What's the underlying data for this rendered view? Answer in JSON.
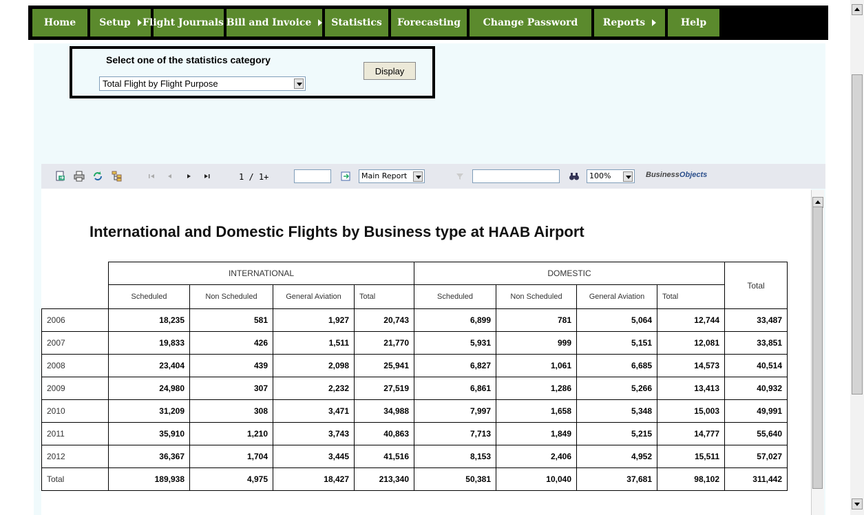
{
  "nav": {
    "items": [
      {
        "label": "Home",
        "arrow": false
      },
      {
        "label": "Setup",
        "arrow": true
      },
      {
        "label": "Flight Journals",
        "arrow": true
      },
      {
        "label": "Bill and Invoice",
        "arrow": true
      },
      {
        "label": "Statistics",
        "arrow": false
      },
      {
        "label": "Forecasting",
        "arrow": false
      },
      {
        "label": "Change Password",
        "arrow": false
      },
      {
        "label": "Reports",
        "arrow": true
      },
      {
        "label": "Help",
        "arrow": false
      }
    ]
  },
  "category": {
    "heading": "Select one of the statistics category",
    "selected": "Total Flight by Flight Purpose",
    "display_label": "Display"
  },
  "toolbar": {
    "page": "1 / 1+",
    "report_select": "Main Report",
    "zoom": "100%",
    "logo_a": "Business",
    "logo_b": "Objects"
  },
  "report": {
    "title_pre": "International and Domestic Flights by Business type at ",
    "airport": "HAAB",
    "title_post": " Airport",
    "group_headers": [
      "INTERNATIONAL",
      "DOMESTIC",
      "Total"
    ],
    "sub_headers": [
      "Scheduled",
      "Non Scheduled",
      "General Aviation",
      "Total",
      "Scheduled",
      "Non Scheduled",
      "General Aviation",
      "Total"
    ],
    "rows": [
      {
        "year": "2006",
        "values": [
          "18,235",
          "581",
          "1,927",
          "20,743",
          "6,899",
          "781",
          "5,064",
          "12,744",
          "33,487"
        ]
      },
      {
        "year": "2007",
        "values": [
          "19,833",
          "426",
          "1,511",
          "21,770",
          "5,931",
          "999",
          "5,151",
          "12,081",
          "33,851"
        ]
      },
      {
        "year": "2008",
        "values": [
          "23,404",
          "439",
          "2,098",
          "25,941",
          "6,827",
          "1,061",
          "6,685",
          "14,573",
          "40,514"
        ]
      },
      {
        "year": "2009",
        "values": [
          "24,980",
          "307",
          "2,232",
          "27,519",
          "6,861",
          "1,286",
          "5,266",
          "13,413",
          "40,932"
        ]
      },
      {
        "year": "2010",
        "values": [
          "31,209",
          "308",
          "3,471",
          "34,988",
          "7,997",
          "1,658",
          "5,348",
          "15,003",
          "49,991"
        ]
      },
      {
        "year": "2011",
        "values": [
          "35,910",
          "1,210",
          "3,743",
          "40,863",
          "7,713",
          "1,849",
          "5,215",
          "14,777",
          "55,640"
        ]
      },
      {
        "year": "2012",
        "values": [
          "36,367",
          "1,704",
          "3,445",
          "41,516",
          "8,153",
          "2,406",
          "4,952",
          "15,511",
          "57,027"
        ]
      },
      {
        "year": "Total",
        "values": [
          "189,938",
          "4,975",
          "18,427",
          "213,340",
          "50,381",
          "10,040",
          "37,681",
          "98,102",
          "311,442"
        ]
      }
    ]
  },
  "icons": {
    "export": "export-icon",
    "print": "print-icon",
    "refresh": "refresh-icon",
    "tree": "group-tree-icon",
    "first": "first-page-icon",
    "prev": "prev-page-icon",
    "next": "next-page-icon",
    "last": "last-page-icon",
    "goto": "goto-page-icon",
    "search": "binoculars-icon"
  }
}
